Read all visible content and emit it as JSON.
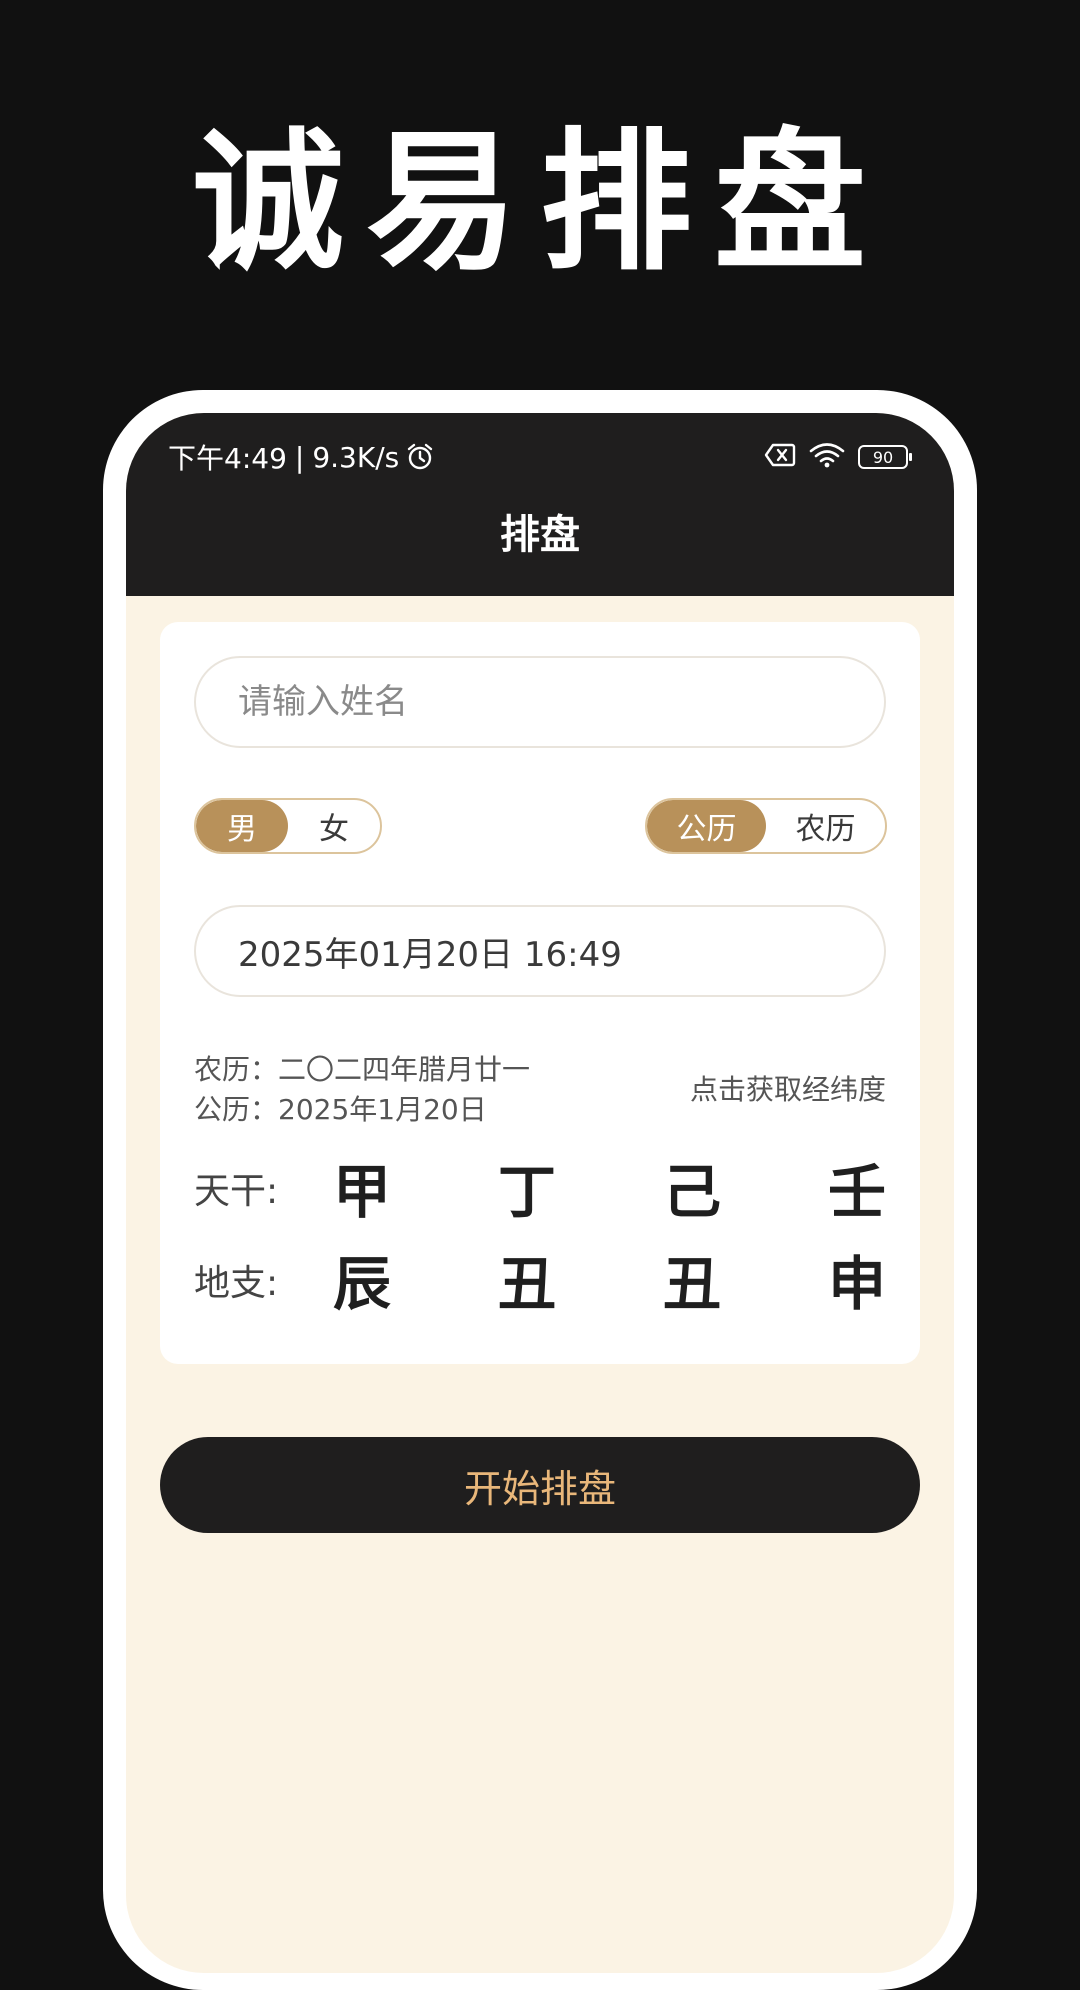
{
  "promo": {
    "title": "诚易排盘"
  },
  "status_bar": {
    "time": "下午4:49",
    "separator": "|",
    "network_speed": "9.3K/s",
    "battery_level": "90",
    "icons": [
      "alarm-icon",
      "sim-off-icon",
      "wifi-icon",
      "battery-icon"
    ]
  },
  "nav": {
    "title": "排盘"
  },
  "form": {
    "name_placeholder": "请输入姓名",
    "gender": {
      "options": [
        "男",
        "女"
      ],
      "selected": "男"
    },
    "calendar_type": {
      "options": [
        "公历",
        "农历"
      ],
      "selected": "公历"
    },
    "datetime": "2025年01月20日 16:49",
    "lunar_date": "农历：二〇二四年腊月廿一",
    "solar_date": "公历：2025年1月20日",
    "location_link": "点击获取经纬度",
    "tiangan": {
      "label": "天干:",
      "chars": [
        "甲",
        "丁",
        "己",
        "壬"
      ]
    },
    "dizhi": {
      "label": "地支:",
      "chars": [
        "辰",
        "丑",
        "丑",
        "申"
      ]
    }
  },
  "start_button": {
    "label": "开始排盘"
  },
  "colors": {
    "page_background": "#111111",
    "header_background": "#1f1e1e",
    "screen_background": "#fbf3e4",
    "accent_gold": "#b8915a",
    "toggle_border": "#dcc49c",
    "button_text": "#e9b77a"
  }
}
